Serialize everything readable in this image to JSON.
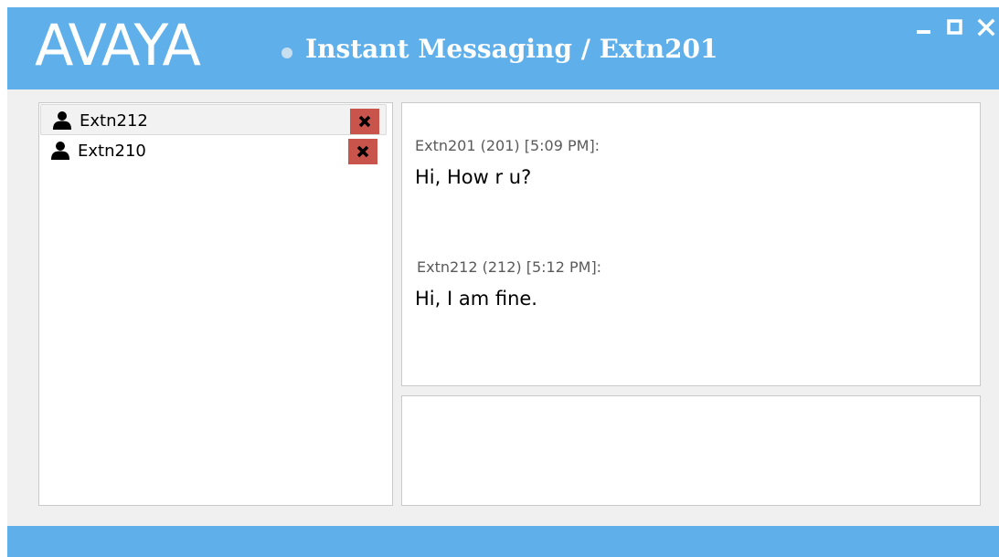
{
  "app": {
    "logo_text": "AVAYA",
    "title": "Instant Messaging / Extn201"
  },
  "window_controls": {
    "minimize_icon": "minimize-icon",
    "maximize_icon": "maximize-icon",
    "close_icon": "close-icon"
  },
  "contacts": [
    {
      "name": "Extn212",
      "icon": "person-icon",
      "selected": true
    },
    {
      "name": "Extn210",
      "icon": "person-icon",
      "selected": false
    }
  ],
  "messages": [
    {
      "sender": "Extn201 (201)  [5:09 PM]:",
      "text": "Hi,  How r u?"
    },
    {
      "sender": "Extn212 (212)  [5:12 PM]:",
      "text": "Hi, I am fine."
    }
  ],
  "colors": {
    "accent": "#5fb0ea",
    "close_button": "#c8544c"
  }
}
